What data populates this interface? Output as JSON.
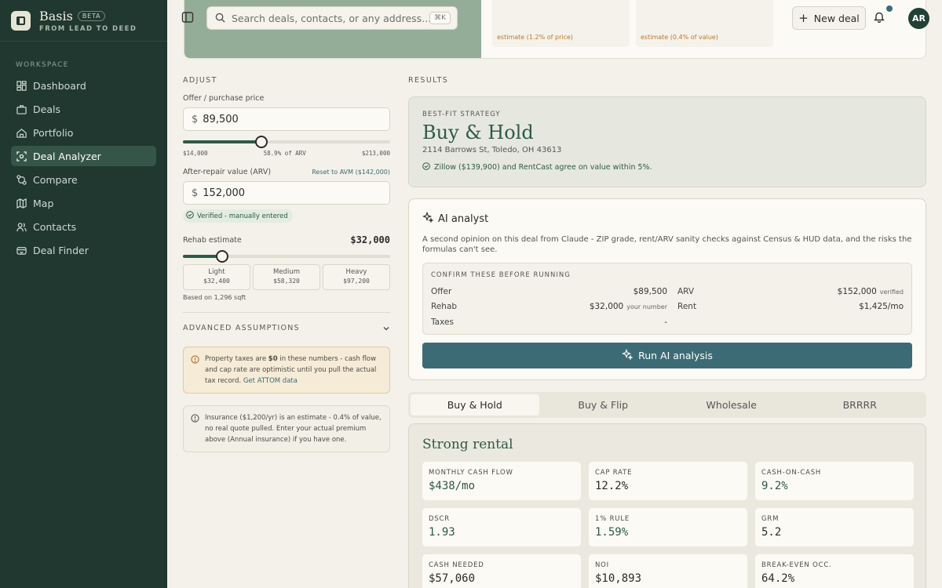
{
  "brand": {
    "name": "Basis",
    "badge": "BETA",
    "tagline": "FROM LEAD TO DEED"
  },
  "sidebar": {
    "section_label": "WORKSPACE",
    "items": [
      {
        "label": "Dashboard",
        "icon": "dashboard-icon",
        "active": false
      },
      {
        "label": "Deals",
        "icon": "deals-icon",
        "active": false
      },
      {
        "label": "Portfolio",
        "icon": "portfolio-icon",
        "active": false
      },
      {
        "label": "Deal Analyzer",
        "icon": "analyzer-icon",
        "active": true
      },
      {
        "label": "Compare",
        "icon": "compare-icon",
        "active": false
      },
      {
        "label": "Map",
        "icon": "map-icon",
        "active": false
      },
      {
        "label": "Contacts",
        "icon": "contacts-icon",
        "active": false
      },
      {
        "label": "Deal Finder",
        "icon": "deal-finder-icon",
        "active": false
      }
    ]
  },
  "topbar": {
    "search_placeholder": "Search deals, contacts, or any address...",
    "shortcut": "⌘K",
    "new_deal_label": "New deal",
    "avatar_initials": "AR",
    "estimate_note_1": "estimate (1.2% of price)",
    "estimate_note_2": "estimate (0.4% of value)"
  },
  "adjust": {
    "section_label": "ADJUST",
    "offer_label": "Offer / purchase price",
    "offer_currency": "$",
    "offer_value": "89,500",
    "offer_min": "$14,000",
    "offer_pct": "58.9% of ARV",
    "offer_max": "$213,000",
    "offer_slider_fraction": 0.38,
    "arv_label": "After-repair value (ARV)",
    "arv_reset": "Reset to AVM ($142,000)",
    "arv_currency": "$",
    "arv_value": "152,000",
    "arv_badge": "Verified - manually entered",
    "rehab_label": "Rehab estimate",
    "rehab_value": "$32,000",
    "rehab_slider_fraction": 0.19,
    "presets": [
      {
        "name": "Light",
        "value": "$32,400"
      },
      {
        "name": "Medium",
        "value": "$58,320"
      },
      {
        "name": "Heavy",
        "value": "$97,200"
      }
    ],
    "sqft_note": "Based on 1,296 sqft",
    "advanced_label": "ADVANCED ASSUMPTIONS",
    "tax_notice_pre": "Property taxes are ",
    "tax_notice_bold": "$0",
    "tax_notice_post": " in these numbers - cash flow and cap rate are optimistic until you pull the actual tax record. ",
    "tax_notice_link": "Get ATTOM data",
    "insurance_notice": "Insurance ($1,200/yr) is an estimate - 0.4% of value, no real quote pulled. Enter your actual premium above (Annual insurance) if you have one."
  },
  "results": {
    "section_label": "RESULTS",
    "bestfit_label": "BEST-FIT STRATEGY",
    "strategy": "Buy & Hold",
    "address": "2114 Barrows St, Toledo, OH 43613",
    "avm_note": "Zillow ($139,900) and RentCast agree on value within 5%."
  },
  "ai": {
    "title": "AI analyst",
    "description": "A second opinion on this deal from Claude - ZIP grade, rent/ARV sanity checks against Census & HUD data, and the risks the formulas can't see.",
    "confirm_label": "CONFIRM THESE BEFORE RUNNING",
    "left_rows": [
      {
        "label": "Offer",
        "value": "$89,500",
        "sub": ""
      },
      {
        "label": "Rehab",
        "value": "$32,000",
        "sub": "your number"
      },
      {
        "label": "Taxes",
        "value": "-",
        "sub": ""
      }
    ],
    "right_rows": [
      {
        "label": "ARV",
        "value": "$152,000",
        "sub": "verified"
      },
      {
        "label": "Rent",
        "value": "$1,425/mo",
        "sub": ""
      }
    ],
    "run_label": "Run AI analysis"
  },
  "tabs": [
    {
      "label": "Buy & Hold",
      "active": true
    },
    {
      "label": "Buy & Flip",
      "active": false
    },
    {
      "label": "Wholesale",
      "active": false
    },
    {
      "label": "BRRRR",
      "active": false
    }
  ],
  "metrics": {
    "title": "Strong rental",
    "items": [
      {
        "label": "MONTHLY CASH FLOW",
        "value": "$438/mo",
        "tone": "good"
      },
      {
        "label": "CAP RATE",
        "value": "12.2%",
        "tone": "neutral"
      },
      {
        "label": "CASH-ON-CASH",
        "value": "9.2%",
        "tone": "good"
      },
      {
        "label": "DSCR",
        "value": "1.93",
        "tone": "good"
      },
      {
        "label": "1% RULE",
        "value": "1.59%",
        "tone": "good"
      },
      {
        "label": "GRM",
        "value": "5.2",
        "tone": "neutral"
      },
      {
        "label": "CASH NEEDED",
        "value": "$57,060",
        "tone": "neutral"
      },
      {
        "label": "NOI",
        "value": "$10,893",
        "tone": "neutral"
      },
      {
        "label": "BREAK-EVEN OCC.",
        "value": "64.2%",
        "tone": "neutral"
      }
    ]
  },
  "colors": {
    "sidebar": "#20382f",
    "accent": "#2d5a46",
    "button": "#3d6b75",
    "warn_bg": "#f6ebd6"
  }
}
